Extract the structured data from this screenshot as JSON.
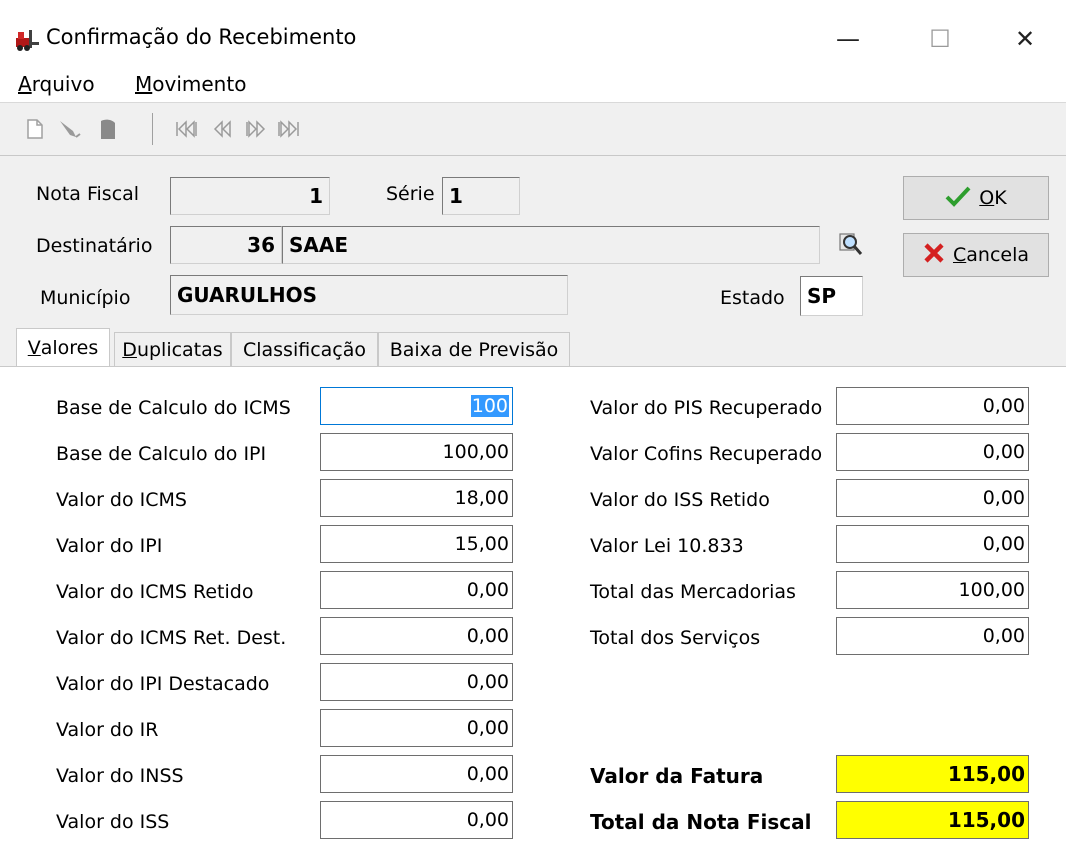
{
  "window": {
    "title": "Confirmação do Recebimento",
    "minimize": "—",
    "maximize": "☐",
    "close": "✕"
  },
  "menu": [
    {
      "accel": "A",
      "rest": "rquivo"
    },
    {
      "accel": "M",
      "rest": "ovimento"
    }
  ],
  "toolbar": {
    "icons": [
      "new-icon",
      "edit-icon",
      "delete-icon",
      "first-record-icon",
      "previous-record-icon",
      "next-record-icon",
      "last-record-icon"
    ]
  },
  "header": {
    "nota_fiscal_label": "Nota Fiscal",
    "nota_fiscal_value": "1",
    "serie_label": "Série",
    "serie_value": "1",
    "destinatario_label": "Destinatário",
    "destinatario_code": "36",
    "destinatario_name": "SAAE",
    "municipio_label": "Município",
    "municipio_value": "GUARULHOS",
    "estado_label": "Estado",
    "estado_value": "SP"
  },
  "buttons": {
    "ok_accel": "O",
    "ok_rest": "K",
    "cancel_accel": "C",
    "cancel_rest": "ancela"
  },
  "tabs": [
    {
      "accel": "V",
      "rest": "alores"
    },
    {
      "accel": "D",
      "rest": "uplicatas"
    },
    {
      "accel": "",
      "rest": "Classificação"
    },
    {
      "accel": "",
      "rest": "Baixa de Previsão"
    }
  ],
  "left_fields": [
    {
      "label": "Base de Calculo do ICMS",
      "value": "100"
    },
    {
      "label": "Base de Calculo do IPI",
      "value": "100,00"
    },
    {
      "label": "Valor do ICMS",
      "value": "18,00"
    },
    {
      "label": "Valor do IPI",
      "value": "15,00"
    },
    {
      "label": "Valor do ICMS Retido",
      "value": "0,00"
    },
    {
      "label": "Valor do ICMS Ret. Dest.",
      "value": "0,00"
    },
    {
      "label": "Valor do IPI Destacado",
      "value": "0,00"
    },
    {
      "label": "Valor do IR",
      "value": "0,00"
    },
    {
      "label": "Valor do INSS",
      "value": "0,00"
    },
    {
      "label": "Valor do ISS",
      "value": "0,00"
    }
  ],
  "right_fields": [
    {
      "label": "Valor do PIS Recuperado",
      "value": "0,00"
    },
    {
      "label": "Valor Cofins Recuperado",
      "value": "0,00"
    },
    {
      "label": "Valor do ISS Retido",
      "value": "0,00"
    },
    {
      "label": "Valor Lei 10.833",
      "value": "0,00"
    },
    {
      "label": "Total das Mercadorias",
      "value": "100,00"
    },
    {
      "label": "Total dos Serviços",
      "value": "0,00"
    }
  ],
  "totals": [
    {
      "label": "Valor da Fatura",
      "value": "115,00"
    },
    {
      "label": "Total da Nota Fiscal",
      "value": "115,00"
    }
  ],
  "colors": {
    "highlight": "#ffff00",
    "selection": "#3399ff",
    "ok_check": "#2e9e2e",
    "cancel_x": "#d42020"
  }
}
